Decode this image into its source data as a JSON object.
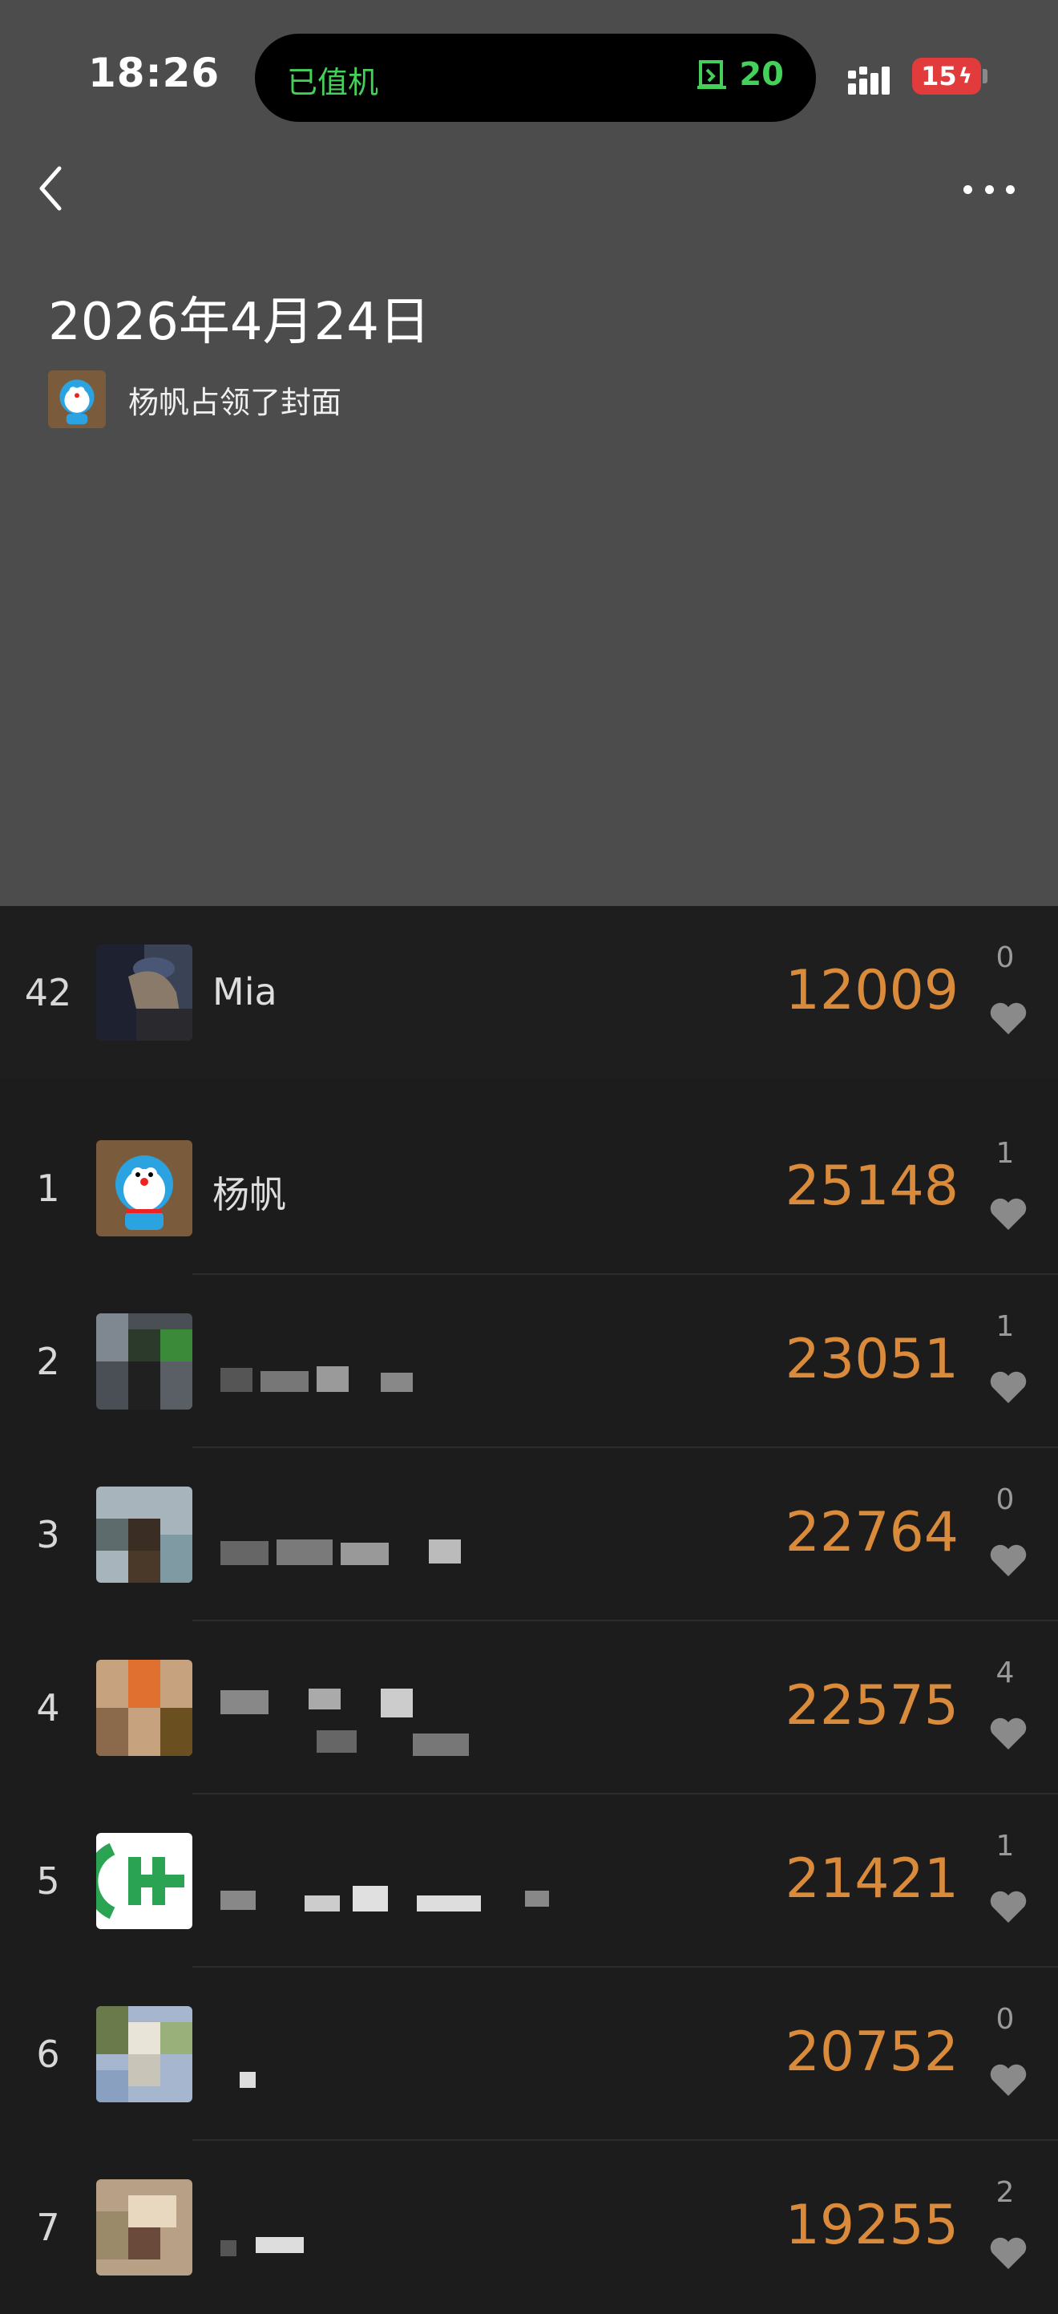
{
  "status_bar": {
    "time": "18:26",
    "island_left": "已值机",
    "island_right_value": "20",
    "battery": "15"
  },
  "header": {
    "back_icon": "chevron-left-icon",
    "more_icon": "ellipsis-icon"
  },
  "cover": {
    "date_title": "2026年4月24日",
    "owner_text": "杨帆占领了封面"
  },
  "colors": {
    "cover_bg": "#4c4c4c",
    "list_bg": "#1c1c1c",
    "steps_color": "#d98a3a",
    "island_text": "#44d15a",
    "battery_bg": "#e23b3b"
  },
  "my_entry": {
    "rank": "42",
    "name": "Mia",
    "steps": "12009",
    "likes": "0"
  },
  "leaderboard": [
    {
      "rank": "1",
      "name": "杨帆",
      "steps": "25148",
      "likes": "1"
    },
    {
      "rank": "2",
      "name": "",
      "steps": "23051",
      "likes": "1"
    },
    {
      "rank": "3",
      "name": "",
      "steps": "22764",
      "likes": "0"
    },
    {
      "rank": "4",
      "name": "",
      "steps": "22575",
      "likes": "4"
    },
    {
      "rank": "5",
      "name": "",
      "steps": "21421",
      "likes": "1"
    },
    {
      "rank": "6",
      "name": "",
      "steps": "20752",
      "likes": "0"
    },
    {
      "rank": "7",
      "name": "",
      "steps": "19255",
      "likes": "2"
    }
  ]
}
